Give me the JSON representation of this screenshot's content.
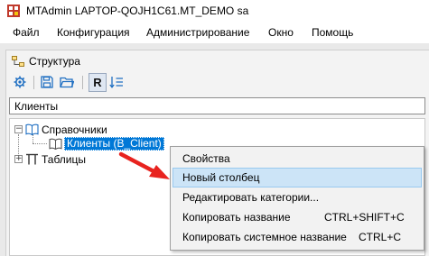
{
  "window": {
    "title": "MTAdmin LAPTOP-QOJH1C61.MT_DEMO sa"
  },
  "menubar": {
    "items": [
      "Файл",
      "Конфигурация",
      "Администрирование",
      "Окно",
      "Помощь"
    ]
  },
  "panel": {
    "title": "Структура"
  },
  "toolbar": {
    "buttons": [
      {
        "icon": "gear-icon"
      },
      {
        "icon": "save-icon"
      },
      {
        "icon": "folder-icon"
      },
      {
        "icon": "r-toggle",
        "label": "R"
      },
      {
        "icon": "sort-list-icon"
      }
    ]
  },
  "filter": {
    "value": "Клиенты"
  },
  "tree": {
    "nodes": [
      {
        "label": "Справочники",
        "expander": "−",
        "children": [
          {
            "label": "Клиенты (B_Client)",
            "selected": true
          }
        ]
      },
      {
        "label": "Таблицы",
        "expander": "+"
      }
    ]
  },
  "context_menu": {
    "items": [
      {
        "label": "Свойства",
        "shortcut": ""
      },
      {
        "label": "Новый столбец",
        "shortcut": "",
        "highlighted": true
      },
      {
        "label": "Редактировать категории...",
        "shortcut": ""
      },
      {
        "label": "Копировать название",
        "shortcut": "CTRL+SHIFT+C"
      },
      {
        "label": "Копировать системное название",
        "shortcut": "CTRL+C"
      }
    ]
  },
  "colors": {
    "selection": "#0078d7",
    "menu_hover": "#cce4f7",
    "arrow": "#e8231f",
    "toolbar_icon": "#1f6fc2"
  }
}
